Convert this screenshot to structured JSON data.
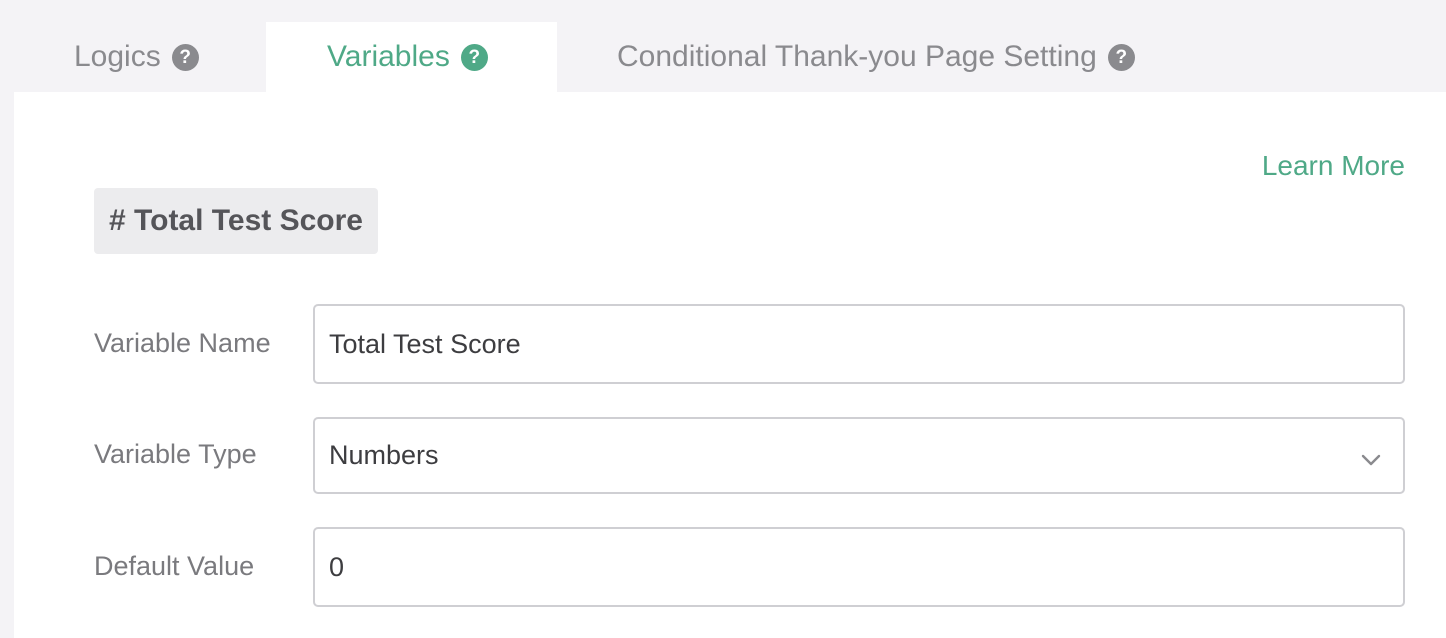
{
  "tabs": {
    "logics": {
      "label": "Logics",
      "help": "?"
    },
    "variables": {
      "label": "Variables",
      "help": "?"
    },
    "conditional": {
      "label": "Conditional Thank-you Page Setting",
      "help": "?"
    }
  },
  "panel": {
    "learn_more": "Learn More",
    "variable_chip": "# Total Test Score",
    "fields": {
      "name": {
        "label": "Variable Name",
        "value": "Total Test Score"
      },
      "type": {
        "label": "Variable Type",
        "value": "Numbers"
      },
      "default": {
        "label": "Default Value",
        "value": "0"
      }
    }
  },
  "colors": {
    "accent": "#4fa987",
    "inactive_tab": "#8a8a8e",
    "page_background": "#f4f3f6"
  },
  "icons": {
    "help": "question-circle-icon",
    "dropdown": "chevron-down-icon"
  }
}
